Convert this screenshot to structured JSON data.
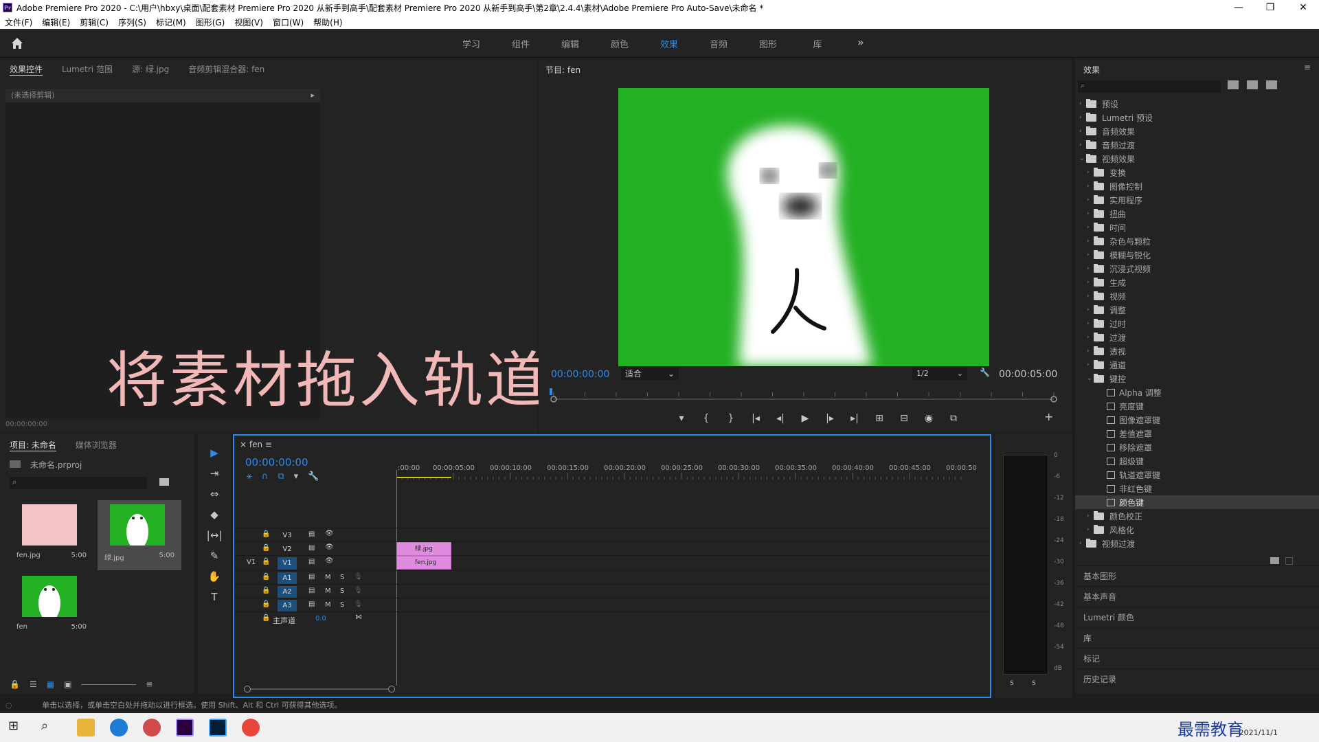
{
  "window": {
    "title": "Adobe Premiere Pro 2020 - C:\\用户\\hbxy\\桌面\\配套素材 Premiere Pro 2020 从新手到高手\\配套素材 Premiere Pro 2020 从新手到高手\\第2章\\2.4.4\\素材\\Adobe Premiere Pro Auto-Save\\未命名 *",
    "logo": "Pr",
    "minimize": "—",
    "maximize": "❐",
    "close": "✕"
  },
  "menu": [
    "文件(F)",
    "编辑(E)",
    "剪辑(C)",
    "序列(S)",
    "标记(M)",
    "图形(G)",
    "视图(V)",
    "窗口(W)",
    "帮助(H)"
  ],
  "workspaces": {
    "tabs": [
      "学习",
      "组件",
      "编辑",
      "颜色",
      "效果",
      "音频",
      "图形",
      "库"
    ],
    "active": "效果",
    "more": "»"
  },
  "effect_controls": {
    "tabs": [
      "效果控件",
      "Lumetri 范围",
      "源: 绿.jpg",
      "音频剪辑混合器: fen"
    ],
    "no_clip": "(未选择剪辑)",
    "timecode": "00:00:00:00"
  },
  "overlay_caption": "将素材拖入轨道",
  "program": {
    "title": "节目: fen",
    "timecode": "00:00:00:00",
    "fit": "适合",
    "resolution": "1/2",
    "duration": "00:00:05:00",
    "controls": [
      "▾",
      "{",
      "}",
      "|◂",
      "◂|",
      "▶",
      "|▸",
      "▸|",
      "⊞",
      "⊟",
      "◉",
      "⧉"
    ],
    "add": "+"
  },
  "effects_panel": {
    "title": "效果",
    "menu": "≡",
    "tree": [
      {
        "label": "预设",
        "level": 0,
        "type": "folder",
        "open": false
      },
      {
        "label": "Lumetri 预设",
        "level": 0,
        "type": "folder",
        "open": false
      },
      {
        "label": "音频效果",
        "level": 0,
        "type": "folder",
        "open": false
      },
      {
        "label": "音频过渡",
        "level": 0,
        "type": "folder",
        "open": false
      },
      {
        "label": "视频效果",
        "level": 0,
        "type": "folder",
        "open": true
      },
      {
        "label": "变换",
        "level": 1,
        "type": "folder",
        "open": false
      },
      {
        "label": "图像控制",
        "level": 1,
        "type": "folder",
        "open": false
      },
      {
        "label": "实用程序",
        "level": 1,
        "type": "folder",
        "open": false
      },
      {
        "label": "扭曲",
        "level": 1,
        "type": "folder",
        "open": false
      },
      {
        "label": "时间",
        "level": 1,
        "type": "folder",
        "open": false
      },
      {
        "label": "杂色与颗粒",
        "level": 1,
        "type": "folder",
        "open": false
      },
      {
        "label": "模糊与锐化",
        "level": 1,
        "type": "folder",
        "open": false
      },
      {
        "label": "沉浸式视频",
        "level": 1,
        "type": "folder",
        "open": false
      },
      {
        "label": "生成",
        "level": 1,
        "type": "folder",
        "open": false
      },
      {
        "label": "视频",
        "level": 1,
        "type": "folder",
        "open": false
      },
      {
        "label": "调整",
        "level": 1,
        "type": "folder",
        "open": false
      },
      {
        "label": "过时",
        "level": 1,
        "type": "folder",
        "open": false
      },
      {
        "label": "过渡",
        "level": 1,
        "type": "folder",
        "open": false
      },
      {
        "label": "透视",
        "level": 1,
        "type": "folder",
        "open": false
      },
      {
        "label": "通道",
        "level": 1,
        "type": "folder",
        "open": false
      },
      {
        "label": "键控",
        "level": 1,
        "type": "folder",
        "open": true
      },
      {
        "label": "Alpha 调整",
        "level": 2,
        "type": "effect"
      },
      {
        "label": "亮度键",
        "level": 2,
        "type": "effect"
      },
      {
        "label": "图像遮罩键",
        "level": 2,
        "type": "effect"
      },
      {
        "label": "差值遮罩",
        "level": 2,
        "type": "effect"
      },
      {
        "label": "移除遮罩",
        "level": 2,
        "type": "effect"
      },
      {
        "label": "超级键",
        "level": 2,
        "type": "effect"
      },
      {
        "label": "轨道遮罩键",
        "level": 2,
        "type": "effect"
      },
      {
        "label": "非红色键",
        "level": 2,
        "type": "effect"
      },
      {
        "label": "颜色键",
        "level": 2,
        "type": "effect",
        "selected": true
      },
      {
        "label": "颜色校正",
        "level": 1,
        "type": "folder",
        "open": false
      },
      {
        "label": "风格化",
        "level": 1,
        "type": "folder",
        "open": false
      },
      {
        "label": "视频过渡",
        "level": 0,
        "type": "folder",
        "open": false
      }
    ],
    "sections": [
      "基本图形",
      "基本声音",
      "Lumetri 颜色",
      "库",
      "标记",
      "历史记录"
    ]
  },
  "project": {
    "tabs": [
      "项目: 未命名",
      "媒体浏览器"
    ],
    "name": "未命名.prproj",
    "items": [
      {
        "name": "fen.jpg",
        "duration": "5:00"
      },
      {
        "name": "绿.jpg",
        "duration": "5:00"
      },
      {
        "name": "fen",
        "duration": "5:00"
      }
    ]
  },
  "tools": [
    "▶",
    "⇥",
    "⇔",
    "◆",
    "|↔|",
    "✎",
    "✋",
    "T"
  ],
  "timeline": {
    "tab": "fen",
    "timecode": "00:00:00:00",
    "ruler": [
      ":00:00",
      "00:00:05:00",
      "00:00:10:00",
      "00:00:15:00",
      "00:00:20:00",
      "00:00:25:00",
      "00:00:30:00",
      "00:00:35:00",
      "00:00:40:00",
      "00:00:45:00",
      "00:00:50"
    ],
    "video_tracks": [
      "V3",
      "V2",
      "V1"
    ],
    "source_patch": "V1",
    "audio_tracks": [
      "A1",
      "A2",
      "A3"
    ],
    "master": {
      "label": "主声道",
      "value": "0.0"
    },
    "clips": [
      {
        "track": "V2",
        "label": "绿.jpg"
      },
      {
        "track": "V1",
        "label": "fen.jpg"
      }
    ],
    "track_m": "M",
    "track_s": "S"
  },
  "meters": {
    "scale": [
      "0",
      "-6",
      "-12",
      "-18",
      "-24",
      "-30",
      "-36",
      "-42",
      "-48",
      "-54",
      "dB"
    ],
    "solo": [
      "S",
      "S"
    ]
  },
  "status_text": "单击以选择，或单击空白处并拖动以进行框选。使用 Shift、Alt 和 Ctrl 可获得其他选项。",
  "taskbar": {
    "date": "2021/11/1",
    "watermark": "最需教育"
  },
  "colors": {
    "accent": "#2d8ceb",
    "screen_green": "#23b023",
    "clip_pink": "#e08be0",
    "overlay_pink": "#f2b8b8"
  }
}
